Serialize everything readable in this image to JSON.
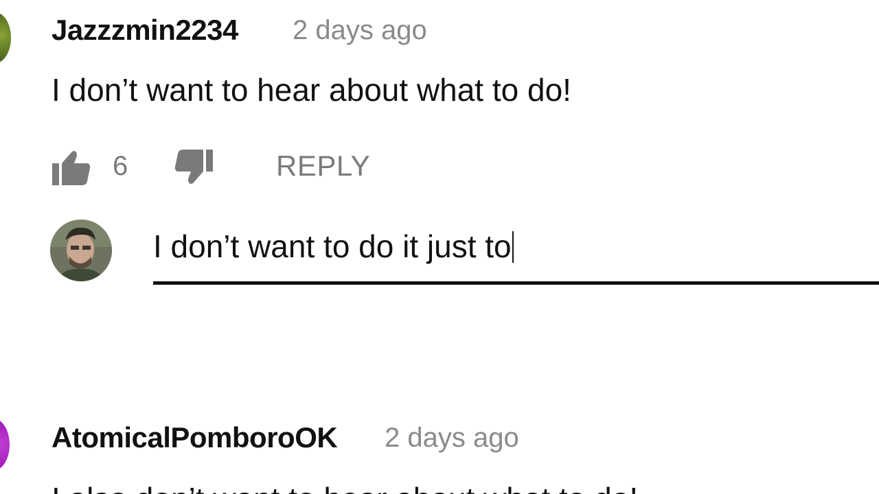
{
  "comments": [
    {
      "author": "Jazzzmin2234",
      "time": "2 days ago",
      "text": "I don’t want to hear about what to do!",
      "likes": "6",
      "reply_label": "REPLY"
    },
    {
      "author": "AtomicalPomboroOK",
      "time": "2 days ago",
      "text": "I also don’t want to hear about what to do!"
    }
  ],
  "reply_box": {
    "value": "I don’t want to do it just to"
  },
  "icons": {
    "like": "thumbs-up-icon",
    "dislike": "thumbs-down-icon"
  },
  "colors": {
    "text": "#111111",
    "muted": "#8a8a8a",
    "icon": "#7a7a7a"
  }
}
